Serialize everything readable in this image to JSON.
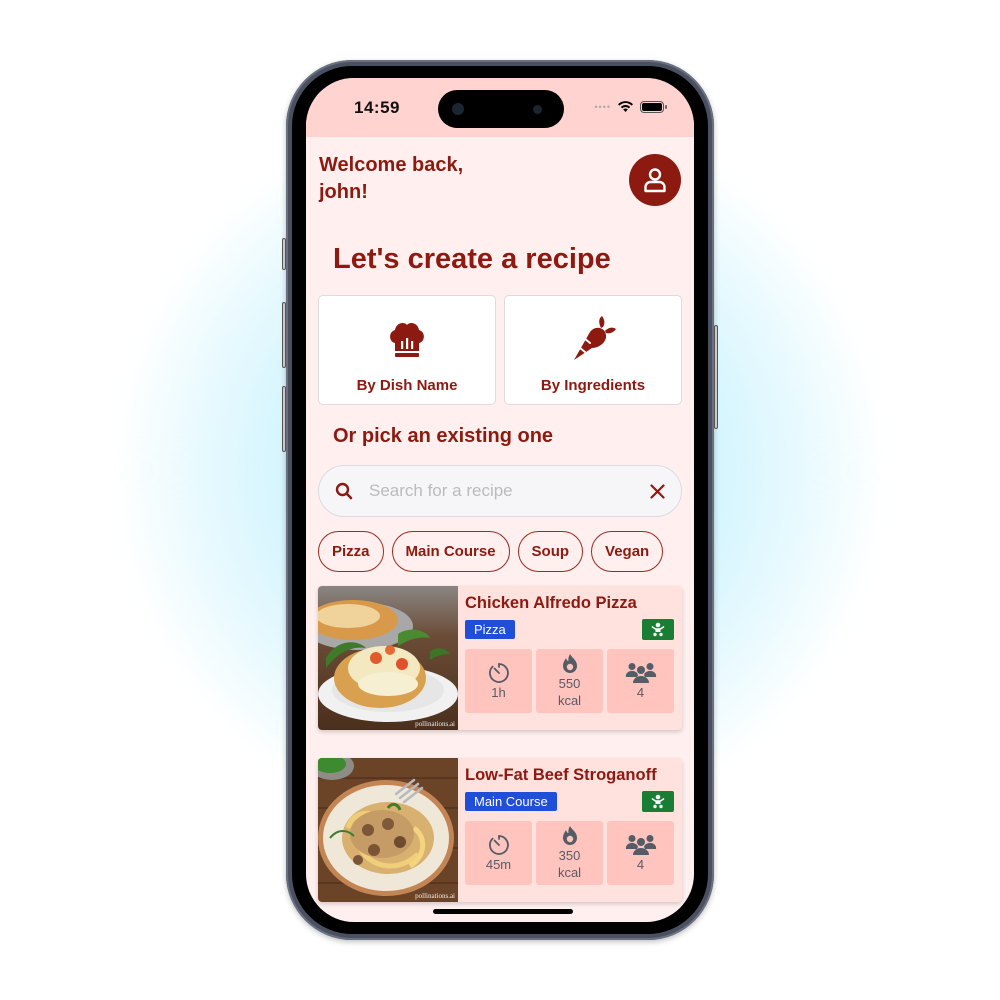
{
  "status_bar": {
    "time": "14:59"
  },
  "header": {
    "welcome": "Welcome back, john!"
  },
  "create": {
    "title": "Let's create a recipe",
    "options": [
      {
        "label": "By Dish Name",
        "icon": "chef-hat-icon"
      },
      {
        "label": "By Ingredients",
        "icon": "carrot-icon"
      }
    ]
  },
  "existing": {
    "title": "Or pick an existing one",
    "search": {
      "placeholder": "Search for a recipe",
      "value": ""
    },
    "chips": [
      "Pizza",
      "Main Course",
      "Soup",
      "Vegan"
    ]
  },
  "recipes": [
    {
      "title": "Chicken Alfredo Pizza",
      "category": "Pizza",
      "kid_friendly": true,
      "time": "1h",
      "calories": "550",
      "calories_unit": "kcal",
      "servings": "4",
      "watermark": "pollinations.ai"
    },
    {
      "title": "Low-Fat Beef Stroganoff",
      "category": "Main Course",
      "kid_friendly": true,
      "time": "45m",
      "calories": "350",
      "calories_unit": "kcal",
      "servings": "4",
      "watermark": "pollinations.ai"
    }
  ],
  "colors": {
    "primary": "#8c1a10",
    "status_bg": "#ffd3cf",
    "page_bg": "#fff0ef",
    "card_bg": "#ffe1de",
    "stat_bg": "#ffc4be",
    "tag_blue": "#1f4fd8",
    "kid_green": "#1a7d34"
  }
}
